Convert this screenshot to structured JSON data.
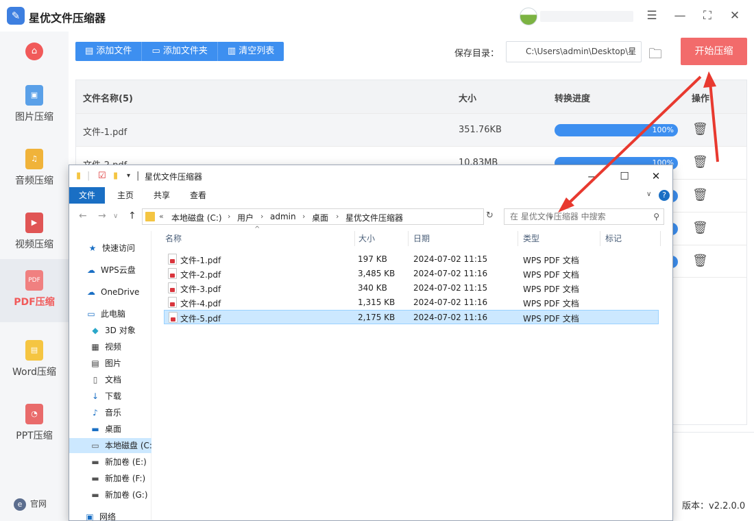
{
  "app": {
    "title": "星优文件压缩器",
    "window_controls": [
      "settings",
      "minimize",
      "maximize",
      "close"
    ]
  },
  "sidebar": {
    "items": [
      {
        "label": "图片压缩",
        "icon": "image-icon"
      },
      {
        "label": "音频压缩",
        "icon": "audio-icon"
      },
      {
        "label": "视频压缩",
        "icon": "video-icon"
      },
      {
        "label": "PDF压缩",
        "icon": "pdf-icon",
        "active": true
      },
      {
        "label": "Word压缩",
        "icon": "word-icon"
      },
      {
        "label": "PPT压缩",
        "icon": "ppt-icon"
      }
    ],
    "footer_link": "官网",
    "footer_icon_glyph": "e"
  },
  "toolbar": {
    "add_file": "添加文件",
    "add_folder": "添加文件夹",
    "clear_list": "清空列表",
    "save_label": "保存目录：",
    "save_path": "C:\\Users\\admin\\Desktop\\星",
    "start_button": "开始压缩"
  },
  "table": {
    "headers": {
      "name": "文件名称(5)",
      "size": "大小",
      "progress": "转换进度",
      "action": "操作"
    },
    "rows": [
      {
        "name": "文件-1.pdf",
        "size": "351.76KB",
        "progress": "100%"
      },
      {
        "name": "文件-2.pdf",
        "size": "10.83MB",
        "progress": "100%"
      }
    ]
  },
  "version": "版本：v2.2.0.0",
  "explorer": {
    "title": "星优文件压缩器",
    "ribbon_tabs": [
      "文件",
      "主页",
      "共享",
      "查看"
    ],
    "help_glyph": "?",
    "breadcrumb": [
      "本地磁盘 (C:)",
      "用户",
      "admin",
      "桌面",
      "星优文件压缩器"
    ],
    "search_placeholder": "在 星优文件压缩器 中搜索",
    "nav": [
      {
        "label": "快速访问",
        "icon": "star-icon"
      },
      {
        "label": "WPS云盘",
        "icon": "cloud-icon"
      },
      {
        "label": "OneDrive",
        "icon": "onedrive-icon"
      },
      {
        "label": "此电脑",
        "icon": "computer-icon"
      },
      {
        "label": "3D 对象",
        "icon": "cube-icon"
      },
      {
        "label": "视频",
        "icon": "video-icon"
      },
      {
        "label": "图片",
        "icon": "picture-icon"
      },
      {
        "label": "文档",
        "icon": "document-icon"
      },
      {
        "label": "下载",
        "icon": "download-icon"
      },
      {
        "label": "音乐",
        "icon": "music-icon"
      },
      {
        "label": "桌面",
        "icon": "desktop-icon"
      },
      {
        "label": "本地磁盘 (C:",
        "icon": "drive-icon",
        "selected": true
      },
      {
        "label": "新加卷 (E:)",
        "icon": "drive-icon"
      },
      {
        "label": "新加卷 (F:)",
        "icon": "drive-icon"
      },
      {
        "label": "新加卷 (G:)",
        "icon": "drive-icon"
      },
      {
        "label": "网络",
        "icon": "network-icon"
      }
    ],
    "columns": [
      "名称",
      "大小",
      "日期",
      "类型",
      "标记"
    ],
    "files": [
      {
        "name": "文件-1.pdf",
        "size": "197 KB",
        "date": "2024-07-02 11:15",
        "type": "WPS PDF 文档"
      },
      {
        "name": "文件-2.pdf",
        "size": "3,485 KB",
        "date": "2024-07-02 11:16",
        "type": "WPS PDF 文档"
      },
      {
        "name": "文件-3.pdf",
        "size": "340 KB",
        "date": "2024-07-02 11:15",
        "type": "WPS PDF 文档"
      },
      {
        "name": "文件-4.pdf",
        "size": "1,315 KB",
        "date": "2024-07-02 11:16",
        "type": "WPS PDF 文档"
      },
      {
        "name": "文件-5.pdf",
        "size": "2,175 KB",
        "date": "2024-07-02 11:16",
        "type": "WPS PDF 文档",
        "selected": true
      }
    ]
  },
  "colors": {
    "accent": "#3d8ff0",
    "brand_red": "#f26b6b",
    "arrow": "#e8392f"
  }
}
